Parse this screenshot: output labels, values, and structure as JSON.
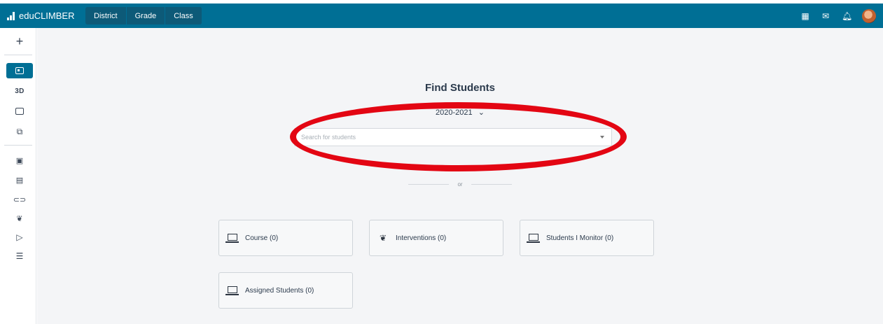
{
  "app": {
    "name": "eduCLIMBER"
  },
  "nav": {
    "tabs": [
      "District",
      "Grade",
      "Class"
    ]
  },
  "top_icons": [
    "calendar-icon",
    "mail-icon",
    "bell-icon",
    "user-avatar"
  ],
  "sidebar": {
    "add_label": "+",
    "items": [
      {
        "name": "student-card",
        "label": ""
      },
      {
        "name": "3d",
        "label": "3D"
      },
      {
        "name": "assessment",
        "label": ""
      },
      {
        "name": "puzzle",
        "label": ""
      }
    ],
    "tools": [
      "calendar-icon",
      "clipboard-icon",
      "tag-icon",
      "intervention-icon",
      "flag-icon",
      "checklist-icon"
    ]
  },
  "main": {
    "title": "Find Students",
    "year": "2020-2021",
    "search": {
      "placeholder": "Search for students",
      "value": ""
    },
    "separator": "or",
    "cards": [
      {
        "label": "Course (0)",
        "icon": "laptop-icon"
      },
      {
        "label": "Interventions (0)",
        "icon": "hands-icon"
      },
      {
        "label": "Students I Monitor (0)",
        "icon": "laptop-icon"
      },
      {
        "label": "Assigned Students (0)",
        "icon": "laptop-icon"
      }
    ]
  },
  "colors": {
    "topbar": "#006f95",
    "tab": "#0d5a78",
    "annotation": "#e30613",
    "background": "#f4f5f7"
  }
}
